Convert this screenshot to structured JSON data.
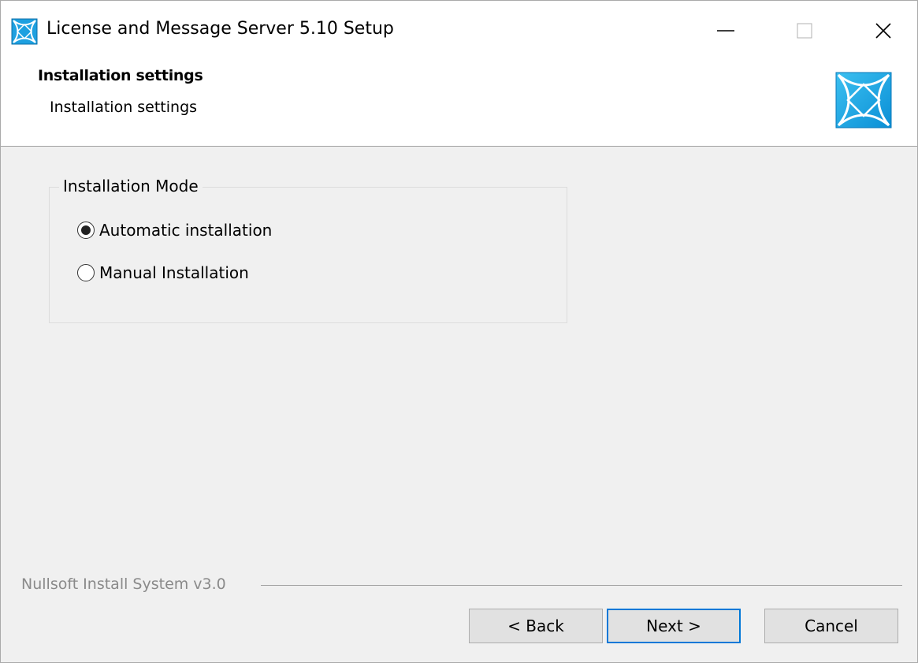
{
  "window": {
    "title": "License and Message Server 5.10 Setup",
    "app_icon": "nsis-star-icon",
    "controls": {
      "minimize": "minimize-icon",
      "maximize": "maximize-icon",
      "close": "close-icon"
    }
  },
  "header": {
    "title": "Installation settings",
    "subtitle": "Installation settings",
    "logo_icon": "nsis-star-icon"
  },
  "installation_mode": {
    "legend": "Installation Mode",
    "options": [
      {
        "label": "Automatic installation",
        "selected": true
      },
      {
        "label": "Manual Installation",
        "selected": false
      }
    ]
  },
  "footer": {
    "branding": "Nullsoft Install System v3.0",
    "buttons": {
      "back": "< Back",
      "next": "Next >",
      "cancel": "Cancel"
    }
  },
  "colors": {
    "background": "#f0f0f0",
    "header_bg": "#ffffff",
    "accent": "#0078d7",
    "logo_blue": "#1ea0e0"
  }
}
